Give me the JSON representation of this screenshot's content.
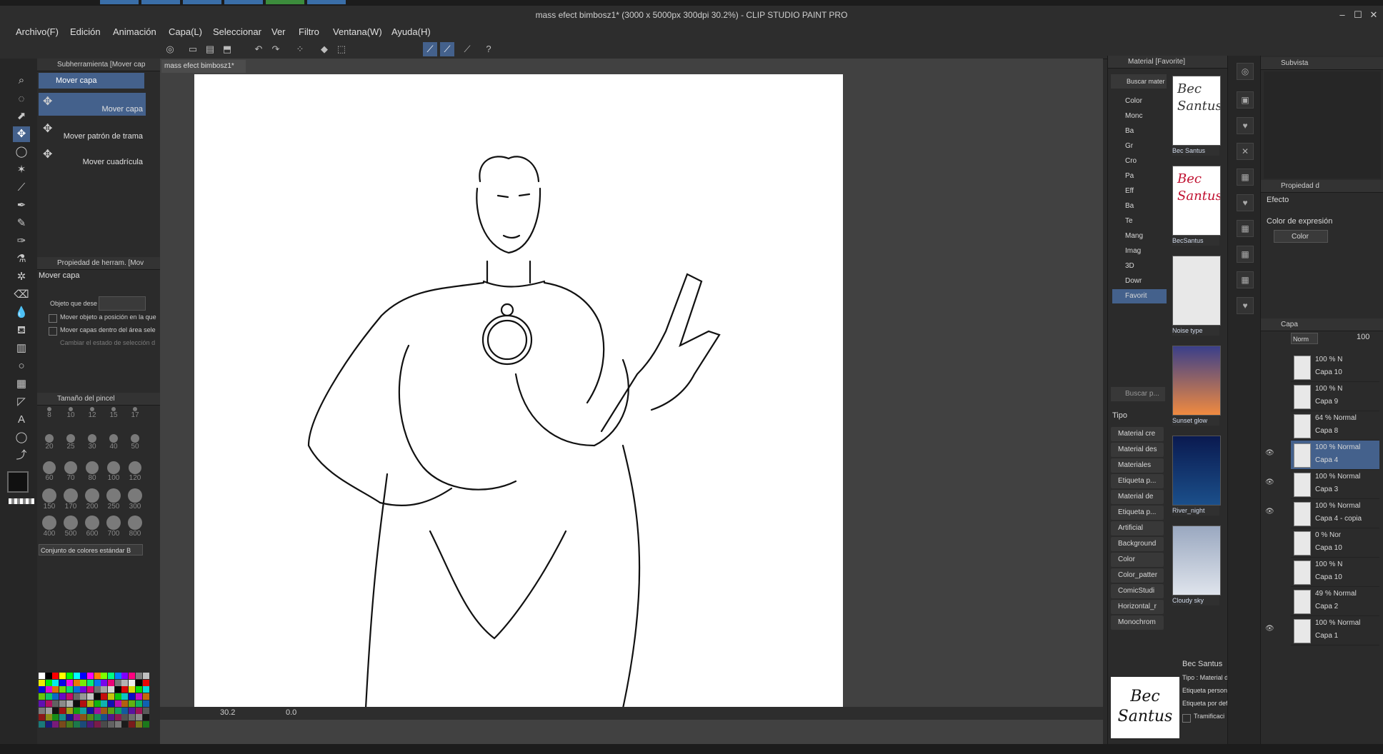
{
  "window": {
    "title": "mass efect bimbosz1* (3000 x 5000px 300dpi 30.2%)  - CLIP STUDIO PAINT PRO",
    "minimize_icon": "minimize-icon",
    "maximize_icon": "maximize-icon",
    "close_icon": "close-icon"
  },
  "menu": [
    "Archivo(F)",
    "Edición",
    "Animación",
    "Capa(L)",
    "Seleccionar",
    "Ver",
    "Filtro",
    "Ventana(W)",
    "Ayuda(H)"
  ],
  "subtool_panel": {
    "header": "Subherramienta [Mover cap",
    "group": "Mover capa",
    "items": [
      "Mover capa",
      "Mover patrón de trama",
      "Mover cuadrícula"
    ]
  },
  "tool_property": {
    "header": "Propiedad de herram. [Mov",
    "tool_name": "Mover capa",
    "target_label": "Objeto que dese",
    "options": [
      "Mover objeto a posición en la que",
      "Mover capas dentro del área sele",
      "Cambiar el estado de selección d"
    ]
  },
  "brush_size": {
    "header": "Tamaño del pincel",
    "sizes": [
      "8",
      "10",
      "12",
      "15",
      "17",
      "20",
      "25",
      "30",
      "40",
      "50",
      "60",
      "70",
      "80",
      "100",
      "120",
      "150",
      "170",
      "200",
      "250",
      "300",
      "400",
      "500",
      "600",
      "700",
      "800"
    ]
  },
  "color_set": {
    "select_label": "Conjunto de colores estándar B"
  },
  "document": {
    "tab_label": "mass efect bimbosz1*"
  },
  "status": {
    "zoom": "30.2",
    "angle": "0.0"
  },
  "material_panel": {
    "header": "Material [Favorite]",
    "search_label": "Buscar mater",
    "tree": [
      "Color",
      "Monc",
      "Ba",
      "Gr",
      "Cro",
      "Pa",
      "Eff",
      "Ba",
      "Te",
      "Mang",
      "Imag",
      "3D",
      "Dowr",
      "Favorit"
    ],
    "search_placeholder": "Buscar p...",
    "tipo_label": "Tipo",
    "tags": [
      "Material cre",
      "Material des",
      "Materiales",
      "Etiqueta p...",
      "Material de",
      "Etiqueta p...",
      "Artificial",
      "Background",
      "Color",
      "Color_patter",
      "ComicStudi",
      "Horizontal_r",
      "Monochrom"
    ],
    "thumbnails": [
      {
        "label": "Bec Santus",
        "text": "Bec Santus"
      },
      {
        "label": "BecSantus",
        "text": "Bec Santus"
      },
      {
        "label": "Noise type",
        "text": ""
      },
      {
        "label": "Sunset glow",
        "text": ""
      },
      {
        "label": "River_night",
        "text": ""
      },
      {
        "label": "Cloudy sky",
        "text": ""
      }
    ],
    "detail": {
      "name": "Bec Santus",
      "tipo": "Tipo : Material d",
      "tag1": "Etiqueta person",
      "tag2": "Etiqueta por def",
      "check": "Tramificaci",
      "preview_text": "Bec Santus"
    }
  },
  "subview": {
    "header": "Subvista"
  },
  "layer_property": {
    "header": "Propiedad d",
    "effect_label": "Efecto",
    "expression_label": "Color de expresión",
    "expression_value": "Color"
  },
  "layers": {
    "header": "Capa",
    "blend_mode": "Norm",
    "opacity": "100",
    "items": [
      {
        "mode": "100 % N",
        "name": "Capa 10",
        "visible": false,
        "selected": false
      },
      {
        "mode": "100 % N",
        "name": "Capa 9",
        "visible": false,
        "selected": false
      },
      {
        "mode": "64 % Normal",
        "name": "Capa 8",
        "visible": false,
        "selected": false
      },
      {
        "mode": "100 % Normal",
        "name": "Capa 4",
        "visible": true,
        "selected": true
      },
      {
        "mode": "100 % Normal",
        "name": "Capa 3",
        "visible": true,
        "selected": false
      },
      {
        "mode": "100 % Normal",
        "name": "Capa 4 - copia",
        "visible": true,
        "selected": false
      },
      {
        "mode": "0 % Nor",
        "name": "Capa 10",
        "visible": false,
        "selected": false
      },
      {
        "mode": "100 % N",
        "name": "Capa 10",
        "visible": false,
        "selected": false
      },
      {
        "mode": "49 % Normal",
        "name": "Capa 2",
        "visible": false,
        "selected": false
      },
      {
        "mode": "100 % Normal",
        "name": "Capa 1",
        "visible": true,
        "selected": false
      }
    ]
  },
  "colors": {
    "accent": "#44618c",
    "panel": "#2b2b2b",
    "canvas_bg": "#414141"
  }
}
